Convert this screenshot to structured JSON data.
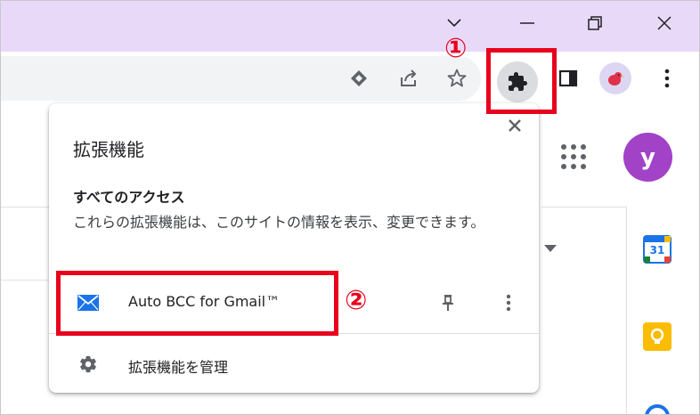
{
  "popup": {
    "title": "拡張機能",
    "close_icon": "close-icon",
    "section_heading": "すべてのアクセス",
    "section_description": "これらの拡張機能は、このサイトの情報を表示、変更できます。",
    "extensions": [
      {
        "name": "Auto BCC for Gmail™",
        "icon": "envelope-icon"
      }
    ],
    "manage_label": "拡張機能を管理"
  },
  "page": {
    "avatar_letter": "y",
    "calendar_day": "31"
  },
  "annotations": {
    "marker_1": "①",
    "marker_2": "②"
  },
  "colors": {
    "annotation_red": "#e8001c",
    "titlebar": "#e9d9f9",
    "avatar_purple": "#a142c7",
    "gmail_icon_blue": "#1a73e8"
  }
}
